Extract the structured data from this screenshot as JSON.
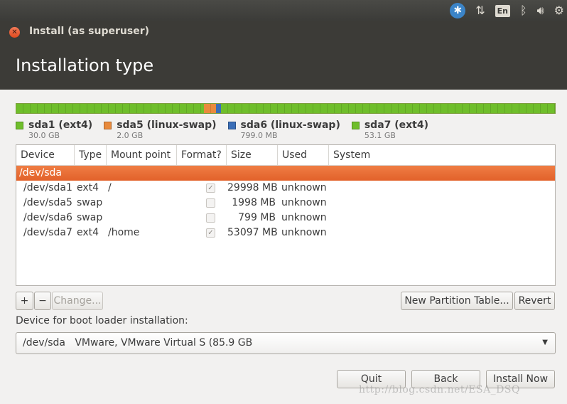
{
  "tray": {
    "icons": [
      "accessibility-icon",
      "network-icon",
      "keyboard-en-icon",
      "bluetooth-icon",
      "volume-icon",
      "settings-gear-icon"
    ],
    "keyboard_label": "En"
  },
  "window": {
    "title": "Install (as superuser)",
    "page_title": "Installation type"
  },
  "colors": {
    "ext4": "#6fbe2b",
    "swap5": "#e98a3c",
    "swap6": "#3a6eb7",
    "selected_row": "#e2612a"
  },
  "legend": [
    {
      "name": "sda1 (ext4)",
      "size": "30.0 GB",
      "color": "#6fbe2b"
    },
    {
      "name": "sda5 (linux-swap)",
      "size": "2.0 GB",
      "color": "#e98a3c"
    },
    {
      "name": "sda6 (linux-swap)",
      "size": "799.0 MB",
      "color": "#3a6eb7"
    },
    {
      "name": "sda7 (ext4)",
      "size": "53.1 GB",
      "color": "#6fbe2b"
    }
  ],
  "table": {
    "headers": [
      "Device",
      "Type",
      "Mount point",
      "Format?",
      "Size",
      "Used",
      "System"
    ],
    "disk": "/dev/sda",
    "rows": [
      {
        "device": "/dev/sda1",
        "type": "ext4",
        "mount": "/",
        "format": true,
        "size": "29998 MB",
        "used": "unknown"
      },
      {
        "device": "/dev/sda5",
        "type": "swap",
        "mount": "",
        "format": false,
        "size": "1998 MB",
        "used": "unknown"
      },
      {
        "device": "/dev/sda6",
        "type": "swap",
        "mount": "",
        "format": false,
        "size": "799 MB",
        "used": "unknown"
      },
      {
        "device": "/dev/sda7",
        "type": "ext4",
        "mount": "/home",
        "format": true,
        "size": "53097 MB",
        "used": "unknown"
      }
    ]
  },
  "controls": {
    "add": "+",
    "remove": "−",
    "change": "Change...",
    "new_table": "New Partition Table...",
    "revert": "Revert"
  },
  "bootloader": {
    "label": "Device for boot loader installation:",
    "value": "/dev/sda   VMware, VMware Virtual S (85.9 GB"
  },
  "footer": {
    "quit": "Quit",
    "back": "Back",
    "install": "Install Now"
  },
  "watermark": "http://blog.csdn.net/ESA_DSQ"
}
